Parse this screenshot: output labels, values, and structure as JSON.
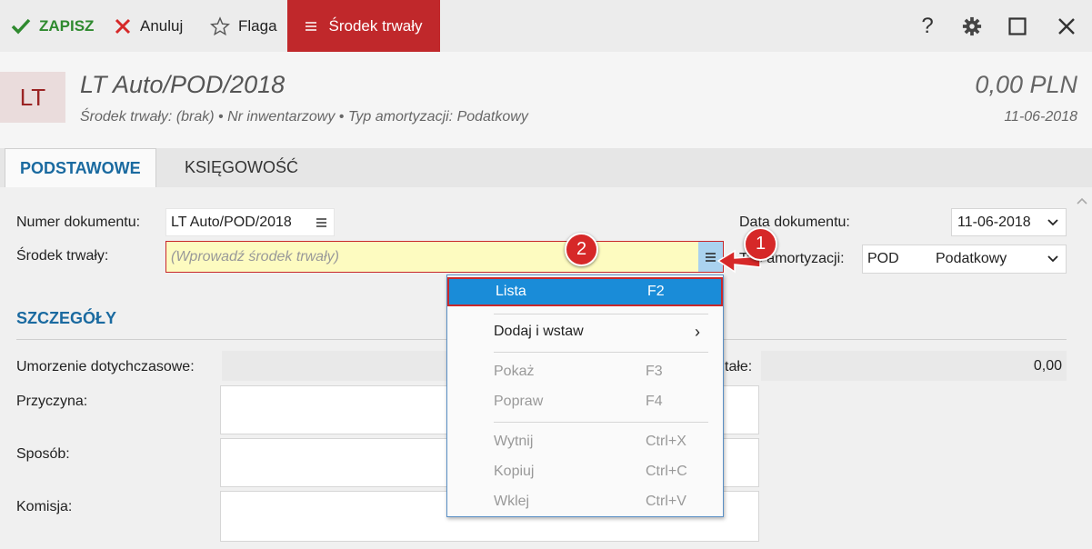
{
  "toolbar": {
    "save": "ZAPISZ",
    "cancel": "Anuluj",
    "flag": "Flaga",
    "asset_tab": "Środek trwały",
    "help": "?"
  },
  "header": {
    "badge": "LT",
    "title": "LT Auto/POD/2018",
    "subtitle": "Środek trwały: (brak) • Nr inwentarzowy • Typ amortyzacji: Podatkowy",
    "amount": "0,00 PLN",
    "date": "11-06-2018"
  },
  "tabs": [
    "PODSTAWOWE",
    "KSIĘGOWOŚĆ"
  ],
  "form": {
    "doc_number_label": "Numer dokumentu:",
    "doc_number_value": "LT Auto/POD/2018",
    "asset_label": "Środek trwały:",
    "asset_placeholder": "(Wprowadź środek trwały)",
    "doc_date_label": "Data dokumentu:",
    "doc_date_value": "11-06-2018",
    "amort_label": "Typ amortyzacji:",
    "amort_code": "POD",
    "amort_name": "Podatkowy"
  },
  "details": {
    "section_title": "SZCZEGÓŁY",
    "depreciation_label": "Umorzenie dotychczasowe:",
    "right_label_partial": "tałe:",
    "right_value": "0,00",
    "reason_label": "Przyczyna:",
    "method_label": "Sposób:",
    "committee_label": "Komisja:"
  },
  "menu": {
    "items": [
      {
        "label": "Lista",
        "key": "F2"
      },
      {
        "label": "Dodaj i wstaw",
        "key": "›"
      },
      {
        "label": "Pokaż",
        "key": "F3"
      },
      {
        "label": "Popraw",
        "key": "F4"
      },
      {
        "label": "Wytnij",
        "key": "Ctrl+X"
      },
      {
        "label": "Kopiuj",
        "key": "Ctrl+C"
      },
      {
        "label": "Wklej",
        "key": "Ctrl+V"
      }
    ]
  },
  "markers": [
    "1",
    "2"
  ],
  "colors": {
    "accent_red": "#c0282b",
    "tab_blue": "#1a6aa0",
    "menu_highlight": "#1a8cd8",
    "field_highlight": "#fdfbc0",
    "save_green": "#2f8a2f"
  }
}
